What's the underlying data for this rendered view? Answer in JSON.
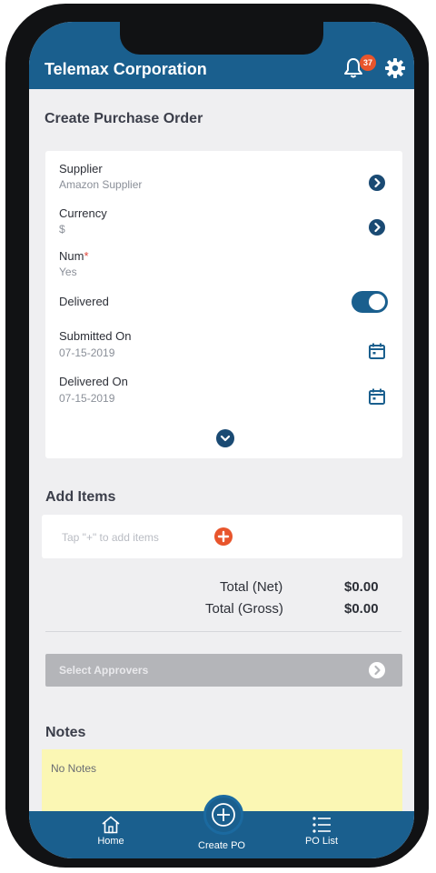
{
  "header": {
    "title": "Telemax Corporation",
    "notification_count": "37",
    "bell_icon": "bell-icon",
    "settings_icon": "gear-icon",
    "color": "#1a5f8e"
  },
  "page": {
    "title": "Create Purchase Order"
  },
  "form": {
    "supplier": {
      "label": "Supplier",
      "value": "Amazon Supplier"
    },
    "currency": {
      "label": "Currency",
      "value": "$"
    },
    "num": {
      "label": "Num",
      "required_mark": "*",
      "value": "Yes"
    },
    "delivered": {
      "label": "Delivered",
      "on": true
    },
    "submitted_on": {
      "label": "Submitted On",
      "value": "07-15-2019"
    },
    "delivered_on": {
      "label": "Delivered On",
      "value": "07-15-2019"
    }
  },
  "items": {
    "title": "Add Items",
    "hint": "Tap \"+\" to add items"
  },
  "totals": {
    "net_label": "Total (Net)",
    "net_value": "$0.00",
    "gross_label": "Total (Gross)",
    "gross_value": "$0.00"
  },
  "approvers": {
    "label": "Select Approvers"
  },
  "notes": {
    "title": "Notes",
    "text": "No Notes"
  },
  "tabbar": {
    "home": "Home",
    "create": "Create PO",
    "list": "PO List"
  }
}
